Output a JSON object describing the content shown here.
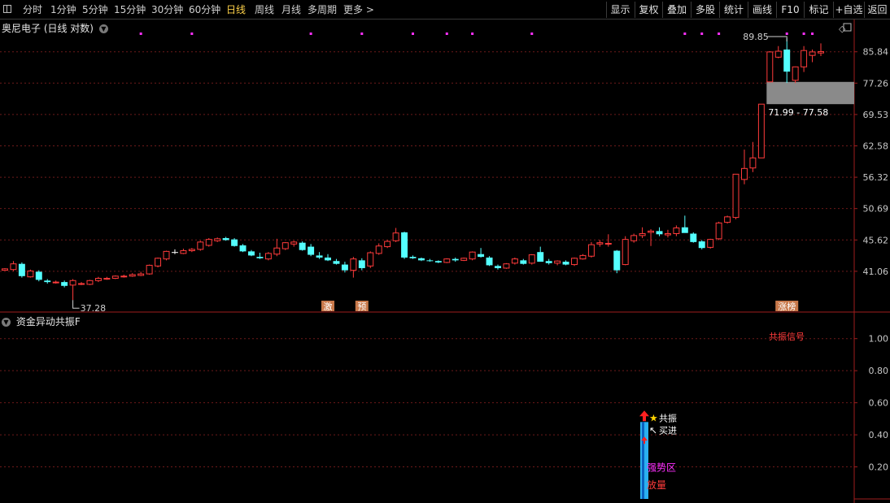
{
  "toolbar": {
    "left_items": [
      {
        "label": "分时",
        "active": false
      },
      {
        "label": "1分钟",
        "active": false
      },
      {
        "label": "5分钟",
        "active": false
      },
      {
        "label": "15分钟",
        "active": false
      },
      {
        "label": "30分钟",
        "active": false
      },
      {
        "label": "60分钟",
        "active": false
      },
      {
        "label": "日线",
        "active": true
      },
      {
        "label": "周线",
        "active": false
      },
      {
        "label": "月线",
        "active": false
      },
      {
        "label": "多周期",
        "active": false
      },
      {
        "label": "更多 >",
        "active": false
      }
    ],
    "right_items": [
      "显示",
      "复权",
      "叠加",
      "多股",
      "统计",
      "画线",
      "F10",
      "标记",
      "+自选",
      "返回"
    ]
  },
  "main_title": "奥尼电子 (日线 对数)",
  "sub_title": "资金异动共振F",
  "colors": {
    "up": "#ff3b3b",
    "down": "#54ffff",
    "flat": "#ffffff",
    "grid": "#6e1a1a",
    "axis_text": "#c8c8c8",
    "border": "#a01e1e",
    "marker": "#ff30ff",
    "tag_bg": "#c8784a"
  },
  "chart_data": [
    {
      "type": "candlestick",
      "title": "奥尼电子 (日线 对数)",
      "y_scale": "log",
      "ylim": [
        37.0,
        89.85
      ],
      "y_ticks": [
        "85.84",
        "77.26",
        "69.53",
        "62.58",
        "56.32",
        "50.69",
        "45.62",
        "41.06"
      ],
      "grid": true,
      "candles": [
        [
          41.2,
          41.5,
          41.2,
          41.4
        ],
        [
          41.3,
          42.5,
          41.1,
          42.1
        ],
        [
          42.1,
          42.3,
          40.2,
          40.4
        ],
        [
          40.3,
          41.3,
          40.2,
          41.1
        ],
        [
          41.0,
          41.2,
          39.7,
          39.9
        ],
        [
          39.8,
          40.0,
          39.4,
          39.6
        ],
        [
          39.5,
          39.8,
          39.4,
          39.6
        ],
        [
          39.6,
          39.8,
          38.9,
          39.1
        ],
        [
          39.2,
          40.0,
          37.28,
          39.8
        ],
        [
          39.3,
          39.6,
          39.2,
          39.4
        ],
        [
          39.3,
          39.9,
          39.2,
          39.8
        ],
        [
          39.8,
          40.3,
          39.6,
          40.1
        ],
        [
          40.0,
          40.3,
          39.9,
          40.1
        ],
        [
          40.1,
          40.5,
          40.0,
          40.4
        ],
        [
          40.3,
          40.6,
          40.2,
          40.4
        ],
        [
          40.4,
          40.8,
          40.3,
          40.6
        ],
        [
          40.5,
          41.0,
          40.4,
          40.7
        ],
        [
          40.7,
          42.0,
          40.6,
          41.9
        ],
        [
          41.8,
          43.0,
          41.6,
          42.9
        ],
        [
          42.8,
          44.0,
          42.6,
          43.9
        ],
        [
          43.8,
          44.2,
          43.5,
          43.8
        ],
        [
          43.6,
          44.3,
          43.5,
          44.0
        ],
        [
          44.0,
          44.4,
          43.8,
          44.2
        ],
        [
          44.2,
          45.5,
          44.0,
          45.3
        ],
        [
          44.8,
          45.9,
          44.6,
          45.7
        ],
        [
          45.5,
          46.0,
          45.3,
          45.8
        ],
        [
          45.9,
          46.1,
          45.5,
          45.6
        ],
        [
          45.7,
          45.9,
          44.6,
          44.7
        ],
        [
          44.8,
          45.0,
          43.8,
          43.9
        ],
        [
          43.9,
          44.1,
          43.2,
          43.3
        ],
        [
          43.1,
          43.7,
          42.8,
          42.9
        ],
        [
          42.8,
          43.8,
          42.6,
          43.6
        ],
        [
          43.5,
          45.8,
          43.2,
          44.4
        ],
        [
          44.3,
          45.3,
          44.1,
          45.2
        ],
        [
          45.0,
          45.5,
          44.6,
          45.3
        ],
        [
          45.2,
          45.4,
          44.0,
          44.1
        ],
        [
          44.6,
          45.0,
          43.2,
          43.4
        ],
        [
          43.3,
          43.8,
          42.8,
          43.0
        ],
        [
          43.0,
          43.5,
          42.5,
          42.6
        ],
        [
          42.5,
          42.8,
          42.0,
          42.1
        ],
        [
          42.0,
          42.4,
          40.9,
          41.2
        ],
        [
          41.2,
          43.1,
          40.2,
          42.8
        ],
        [
          42.6,
          42.9,
          41.2,
          41.5
        ],
        [
          41.8,
          43.9,
          41.5,
          43.7
        ],
        [
          43.6,
          45.1,
          43.4,
          44.7
        ],
        [
          44.6,
          45.6,
          44.4,
          45.4
        ],
        [
          45.5,
          47.5,
          45.3,
          46.7
        ],
        [
          46.8,
          46.9,
          42.8,
          43.0
        ],
        [
          43.1,
          43.3,
          42.8,
          42.9
        ],
        [
          42.9,
          43.0,
          42.5,
          42.6
        ],
        [
          42.6,
          42.8,
          42.4,
          42.5
        ],
        [
          42.5,
          42.6,
          42.2,
          42.3
        ],
        [
          42.3,
          42.9,
          42.2,
          42.8
        ],
        [
          42.8,
          43.0,
          42.4,
          42.6
        ],
        [
          42.6,
          43.0,
          42.5,
          42.9
        ],
        [
          42.8,
          43.9,
          42.6,
          43.8
        ],
        [
          43.5,
          44.4,
          43.0,
          43.1
        ],
        [
          43.0,
          43.2,
          41.8,
          41.9
        ],
        [
          41.8,
          42.0,
          41.3,
          41.5
        ],
        [
          41.5,
          42.2,
          41.4,
          42.1
        ],
        [
          42.2,
          43.0,
          42.0,
          42.8
        ],
        [
          42.6,
          42.8,
          42.0,
          42.1
        ],
        [
          42.2,
          43.5,
          42.0,
          43.4
        ],
        [
          43.8,
          44.6,
          43.4,
          42.4
        ],
        [
          42.5,
          42.8,
          42.0,
          42.2
        ],
        [
          42.2,
          42.6,
          41.9,
          42.5
        ],
        [
          42.4,
          42.6,
          41.9,
          42.0
        ],
        [
          42.0,
          43.0,
          41.8,
          42.9
        ],
        [
          42.8,
          43.5,
          42.7,
          43.3
        ],
        [
          43.2,
          45.3,
          43.0,
          44.9
        ],
        [
          45.0,
          45.6,
          44.6,
          45.2
        ],
        [
          45.0,
          46.5,
          44.6,
          45.1
        ],
        [
          44.0,
          44.1,
          40.8,
          41.2
        ],
        [
          42.0,
          46.2,
          41.9,
          45.7
        ],
        [
          45.5,
          46.6,
          45.2,
          46.3
        ],
        [
          46.3,
          47.6,
          45.9,
          46.6
        ],
        [
          46.8,
          47.3,
          44.7,
          47.0
        ],
        [
          47.0,
          47.6,
          46.2,
          46.5
        ],
        [
          46.4,
          47.2,
          46.0,
          46.6
        ],
        [
          46.6,
          47.9,
          46.2,
          47.5
        ],
        [
          47.6,
          49.5,
          47.0,
          46.7
        ],
        [
          46.6,
          46.8,
          45.2,
          45.3
        ],
        [
          45.4,
          45.6,
          44.2,
          44.4
        ],
        [
          44.5,
          45.8,
          44.3,
          45.7
        ],
        [
          45.8,
          48.5,
          45.6,
          48.3
        ],
        [
          48.4,
          49.5,
          48.2,
          49.3
        ],
        [
          49.2,
          56.9,
          48.9,
          56.9
        ],
        [
          55.9,
          61.8,
          55.0,
          58.0
        ],
        [
          58.1,
          63.4,
          57.3,
          60.1
        ],
        [
          60.1,
          71.99,
          60.1,
          71.99
        ],
        [
          77.58,
          86.0,
          77.58,
          85.8
        ],
        [
          84.3,
          87.5,
          84.0,
          86.0
        ],
        [
          86.5,
          89.85,
          77.3,
          80.3
        ],
        [
          78.0,
          81.7,
          77.26,
          81.6
        ],
        [
          81.6,
          87.5,
          80.2,
          86.2
        ],
        [
          84.8,
          86.5,
          82.9,
          85.8
        ],
        [
          85.5,
          88.3,
          84.6,
          85.9
        ]
      ],
      "annotations": {
        "low_label": "37.28",
        "high_label": "89.85",
        "gap_label": "71.99 - 77.58",
        "gap_range": [
          71.99,
          77.58
        ],
        "signal_tags": [
          {
            "index": 38,
            "text": "激"
          },
          {
            "index": 42,
            "text": "预"
          },
          {
            "index": 92,
            "text": "涨榜"
          }
        ],
        "marker_indices": [
          16,
          22,
          36,
          42,
          48,
          52,
          55,
          62,
          80,
          82,
          84,
          92,
          94,
          95
        ]
      }
    },
    {
      "type": "bar",
      "title": "资金异动共振F",
      "ylim": [
        0,
        1.1
      ],
      "y_ticks": [
        "1.00",
        "0.80",
        "0.60",
        "0.40",
        "0.20"
      ],
      "grid": true,
      "legend_text": "共振信号",
      "bar": {
        "index": 79,
        "value": 0.48
      },
      "labels": [
        "共振",
        "买进",
        "强势区",
        "放量"
      ]
    }
  ]
}
